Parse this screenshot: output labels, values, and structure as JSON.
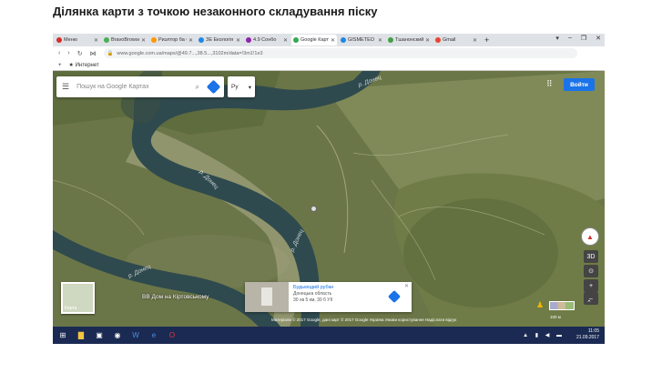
{
  "page_title": "Ділянка карти з точкою незаконного складування піску",
  "browser": {
    "tabs": [
      {
        "label": "Меню",
        "color": "#d32f2f",
        "active": false
      },
      {
        "label": "BravoBrowse",
        "color": "#4caf50",
        "active": false
      },
      {
        "label": "Риэлтор ба бр",
        "color": "#ff9800",
        "active": false
      },
      {
        "label": "ЗЕ Екологія",
        "color": "#1e88e5",
        "active": false
      },
      {
        "label": "4.9 Сонбо",
        "color": "#8e24aa",
        "active": false
      },
      {
        "label": "Google Карти",
        "color": "#34a853",
        "active": true
      },
      {
        "label": "GISMETEO",
        "color": "#1e88e5",
        "active": false
      },
      {
        "label": "Тшанонский",
        "color": "#43a047",
        "active": false
      },
      {
        "label": "Gmail",
        "color": "#ea4335",
        "active": false
      }
    ],
    "new_tab": "+",
    "url": "www.google.com.ua/maps/@49.7...,38.5...,3102m/data=!3m1!1e3",
    "bookmarks_label": "Интернет"
  },
  "map": {
    "search_placeholder": "Пошук на Google Картах",
    "language": "Ру",
    "signin_label": "Войти",
    "river_labels": [
      "р. Донец",
      "р. Донец",
      "р. Донец",
      "р. Донец"
    ],
    "minimap_label": "Карта",
    "place_label": "ВВ Дом на Кіртовському",
    "infocard": {
      "title": "Будьмодий рубки",
      "line2": "Донецька область",
      "line3": "30 хв 5 км, 30 б УІІ"
    },
    "ctrl_3d": "3D",
    "ctrl_plus": "+",
    "ctrl_minus": "–",
    "scale": "100 м",
    "footer": "Матеріали © 2017 Google, дані карт © 2017 Google   Україна   Умови користування   Надіслати відгук"
  },
  "taskbar": {
    "time": "11:05",
    "date": "21.09.2017"
  },
  "colors": {
    "signin": "#1a73e8",
    "taskbar": "#1b2a52",
    "water": "#2f4a4e"
  }
}
